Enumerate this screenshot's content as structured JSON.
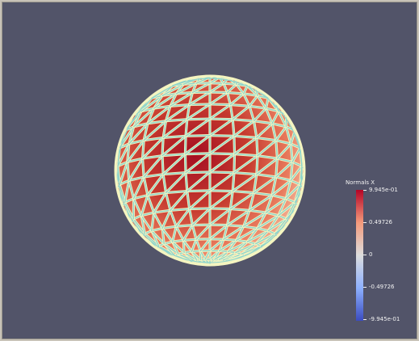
{
  "legend": {
    "title": "Normals X",
    "ticks": [
      "9.945e-01",
      "0.49726",
      "0",
      "-0.49726",
      "-9.945e-01"
    ]
  },
  "colors": {
    "background": "#525469",
    "sphere_core": "#b40426",
    "sphere_edge": "#f0a58a",
    "wireframe": "#f5f5c0",
    "wire_inner": "#8fd4cc"
  }
}
